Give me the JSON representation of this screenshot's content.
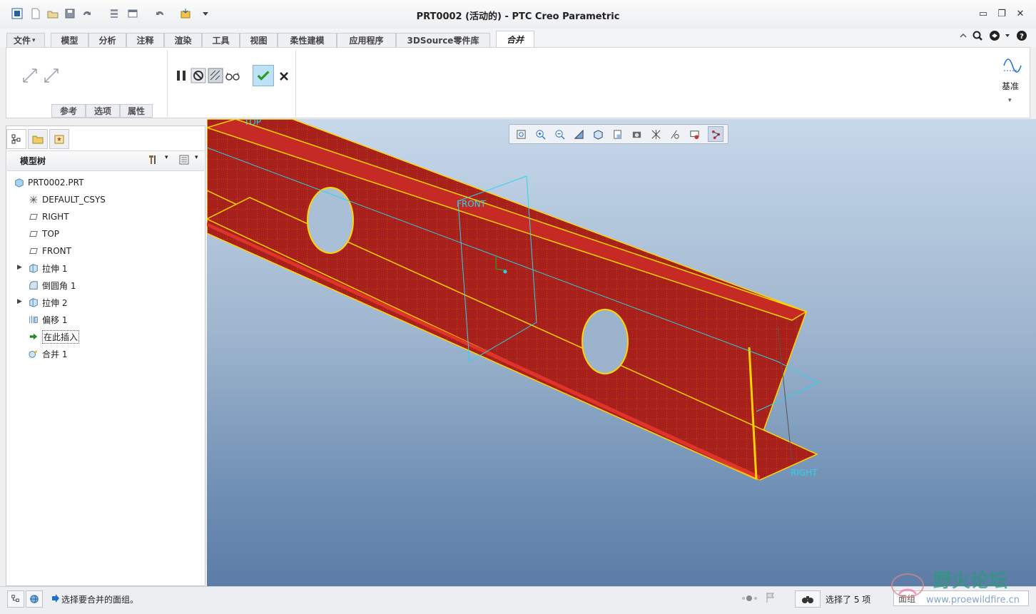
{
  "window": {
    "title": "PRT0002 (活动的) - PTC Creo Parametric",
    "controls": {
      "minimize": "▭",
      "restore": "❐",
      "close": "✕"
    }
  },
  "quick_access": [
    "new-icon",
    "open-icon",
    "save-icon",
    "redo-icon",
    "regenerate-icon",
    "window-icon",
    "undo-icon",
    "close-window-icon",
    "customize-icon"
  ],
  "ribbon": {
    "tabs": [
      {
        "label": "文件",
        "dropdown": "▾"
      },
      {
        "label": "模型"
      },
      {
        "label": "分析"
      },
      {
        "label": "注释"
      },
      {
        "label": "渲染"
      },
      {
        "label": "工具"
      },
      {
        "label": "视图"
      },
      {
        "label": "柔性建模"
      },
      {
        "label": "应用程序"
      },
      {
        "label": "3DSource零件库"
      },
      {
        "label": "合并",
        "active": true
      }
    ],
    "subtabs": [
      "参考",
      "选项",
      "属性"
    ],
    "datum_label": "基准"
  },
  "left_panel": {
    "title": "模型树",
    "items": [
      {
        "label": "PRT0002.PRT",
        "icon": "part-icon",
        "indent": 0,
        "expandable": false
      },
      {
        "label": "DEFAULT_CSYS",
        "icon": "csys-icon",
        "indent": 1,
        "expandable": false
      },
      {
        "label": "RIGHT",
        "icon": "datum-plane-icon",
        "indent": 1,
        "expandable": false
      },
      {
        "label": "TOP",
        "icon": "datum-plane-icon",
        "indent": 1,
        "expandable": false
      },
      {
        "label": "FRONT",
        "icon": "datum-plane-icon",
        "indent": 1,
        "expandable": false
      },
      {
        "label": "拉伸 1",
        "icon": "extrude-icon",
        "indent": 1,
        "expandable": true
      },
      {
        "label": "倒圆角 1",
        "icon": "round-icon",
        "indent": 1,
        "expandable": false
      },
      {
        "label": "拉伸 2",
        "icon": "extrude-icon",
        "indent": 1,
        "expandable": true
      },
      {
        "label": "偏移 1",
        "icon": "offset-icon",
        "indent": 1,
        "expandable": false
      },
      {
        "label": "在此插入",
        "icon": "insert-arrow-icon",
        "indent": 1,
        "expandable": false,
        "boxed": true
      },
      {
        "label": "合并 1",
        "icon": "merge-icon",
        "indent": 1,
        "expandable": false
      }
    ],
    "expand_glyph": "▶"
  },
  "viewport": {
    "datum_labels": {
      "top": "TOP",
      "front": "FRONT",
      "right": "RIGHT"
    }
  },
  "status": {
    "message": "选择要合并的面组。",
    "selection": "选择了 5 项",
    "filter": "面组"
  },
  "colors": {
    "accent": "#1e6fcf",
    "model_red": "#b41e1e",
    "model_edge": "#ffd400",
    "datum_cyan": "#2ad4e8",
    "ok_green": "#2a9a2a"
  },
  "watermark": {
    "title": "野火论坛",
    "url": "www.proewildfire.cn"
  }
}
